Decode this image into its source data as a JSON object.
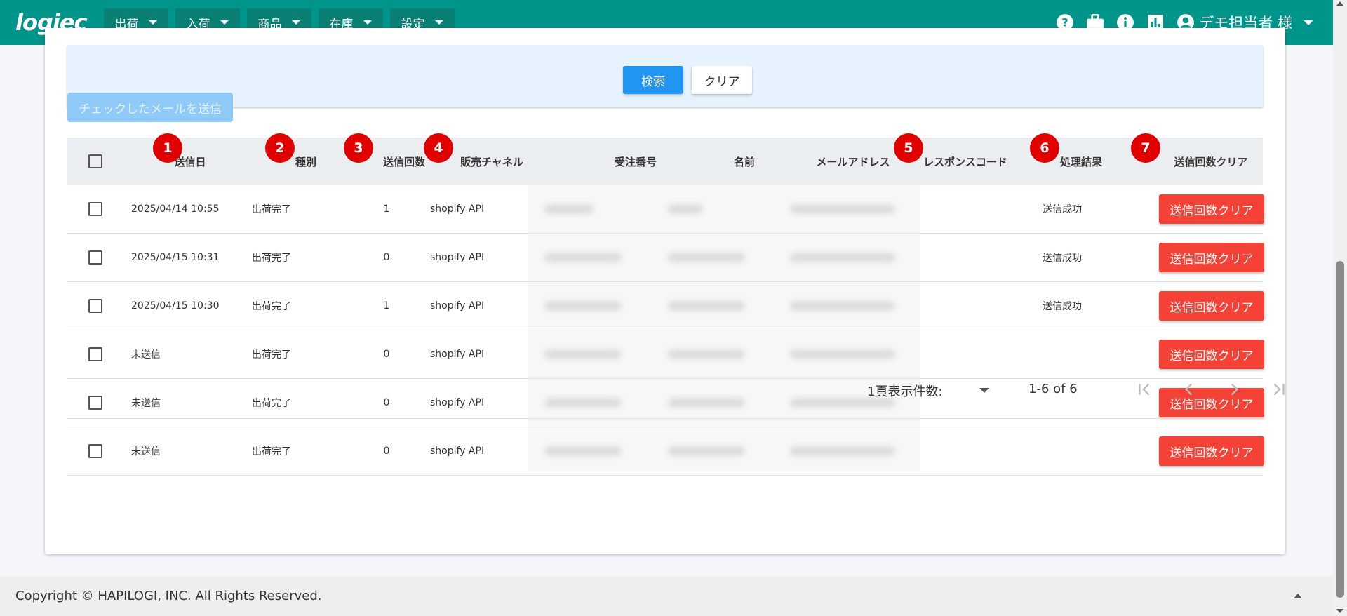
{
  "nav": {
    "logo": "logiec",
    "menus": [
      "出荷",
      "入荷",
      "商品",
      "在庫",
      "設定"
    ],
    "icons": [
      "help-icon",
      "briefcase-icon",
      "info-icon",
      "chart-icon",
      "account-icon"
    ],
    "user": "デモ担当者 様"
  },
  "search": {
    "search_label": "検索",
    "clear_label": "クリア"
  },
  "send_checked_label": "チェックしたメールを送信",
  "table": {
    "headers": [
      "送信日",
      "種別",
      "送信回数",
      "販売チャネル",
      "受注番号",
      "名前",
      "メールアドレス",
      "レスポンスコード",
      "処理結果",
      "送信回数クリア"
    ],
    "rows": [
      {
        "date": "2025/04/14 10:55",
        "type": "出荷完了",
        "count": "1",
        "channel": "shopify API",
        "result": "送信成功",
        "action": "送信回数クリア"
      },
      {
        "date": "2025/04/15 10:31",
        "type": "出荷完了",
        "count": "0",
        "channel": "shopify API",
        "result": "送信成功",
        "action": "送信回数クリア"
      },
      {
        "date": "2025/04/15 10:30",
        "type": "出荷完了",
        "count": "1",
        "channel": "shopify API",
        "result": "送信成功",
        "action": "送信回数クリア"
      },
      {
        "date": "未送信",
        "type": "出荷完了",
        "count": "0",
        "channel": "shopify API",
        "result": "",
        "action": "送信回数クリア"
      },
      {
        "date": "未送信",
        "type": "出荷完了",
        "count": "0",
        "channel": "shopify API",
        "result": "",
        "action": "送信回数クリア"
      },
      {
        "date": "未送信",
        "type": "出荷完了",
        "count": "0",
        "channel": "shopify API",
        "result": "",
        "action": "送信回数クリア"
      }
    ]
  },
  "badges": [
    "1",
    "2",
    "3",
    "4",
    "5",
    "6",
    "7"
  ],
  "pagination": {
    "per_page_label": "1頁表示件数:",
    "range": "1-6 of 6"
  },
  "footer": {
    "copyright": "Copyright © HAPILOGI, INC. All Rights Reserved."
  },
  "colors": {
    "nav": "#00958a",
    "primary": "#2196f3",
    "danger": "#f44336",
    "badge": "#e10000"
  }
}
